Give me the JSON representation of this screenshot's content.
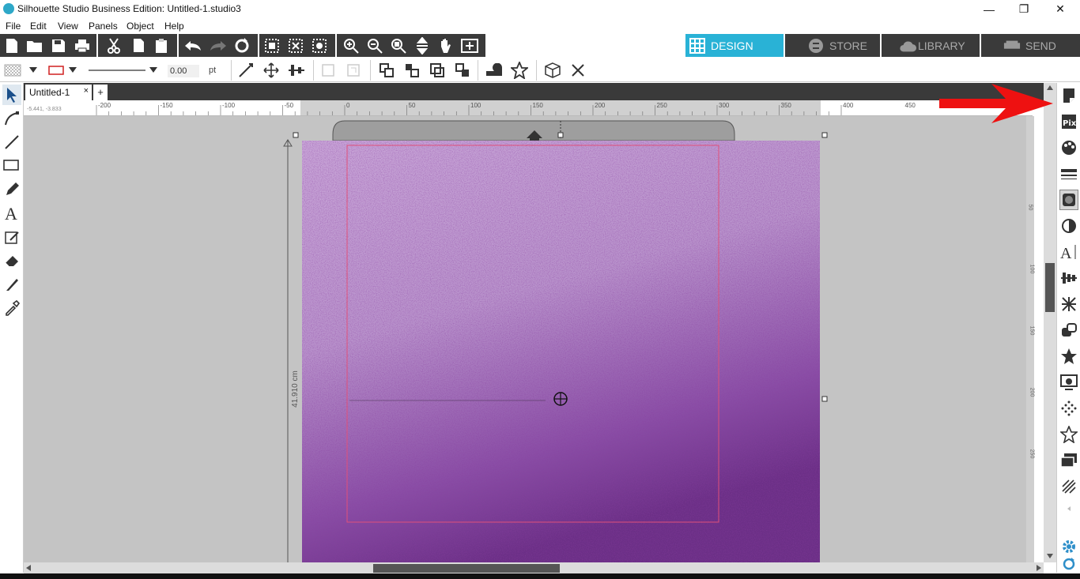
{
  "window": {
    "title": "Silhouette Studio Business Edition: Untitled-1.studio3",
    "minimize": "—",
    "restore": "❐",
    "close": "✕"
  },
  "menu": [
    "File",
    "Edit",
    "View",
    "Panels",
    "Object",
    "Help"
  ],
  "nav_tabs": [
    {
      "label": "DESIGN",
      "icon": "grid-icon",
      "active": true
    },
    {
      "label": "STORE",
      "icon": "store-icon",
      "active": false
    },
    {
      "label": "LIBRARY",
      "icon": "cloud-icon",
      "active": false
    },
    {
      "label": "SEND",
      "icon": "send-icon",
      "active": false
    }
  ],
  "line_style": {
    "width_value": "0.00",
    "unit": "pt"
  },
  "document": {
    "tab_label": "Untitled-1",
    "tab_close": "×",
    "add_tab": "+"
  },
  "ruler": {
    "coordinates": "-5.441, -3.833",
    "labels": [
      "-200",
      "-150",
      "-100",
      "-50",
      "0",
      "50",
      "100",
      "150",
      "200",
      "250",
      "300",
      "350",
      "400",
      "450"
    ],
    "right_labels": [
      "50",
      "100",
      "150",
      "200",
      "250"
    ]
  },
  "selection": {
    "height_label": "41.910 cm"
  },
  "colors": {
    "accent": "#29b2d6",
    "toolbar_dark": "#3a3a3a",
    "canvas": "#c4c4c4",
    "cut_line": "#e0507a",
    "arrow_red": "#ee1111",
    "glitter_light": "#caa3d6",
    "glitter_dark": "#6b2f86"
  }
}
